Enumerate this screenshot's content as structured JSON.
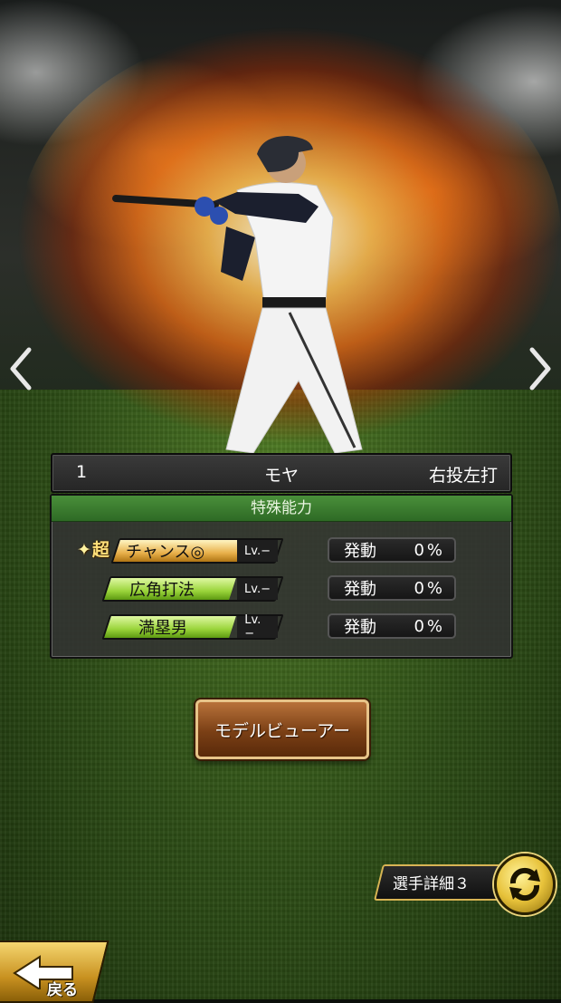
{
  "player": {
    "number": "1",
    "name": "モヤ",
    "handedness": "右投左打"
  },
  "abilities": {
    "header": "特殊能力",
    "items": [
      {
        "prefix": "超",
        "name": "チャンス◎",
        "level": "Lv.−",
        "effect_label": "発動",
        "effect_value": "0%",
        "color": "#e8b04a"
      },
      {
        "prefix": "",
        "name": "広角打法",
        "level": "Lv.−",
        "effect_label": "発動",
        "effect_value": "0%",
        "color": "#9ad43a"
      },
      {
        "prefix": "",
        "name": "満塁男",
        "level": "Lv.−",
        "effect_label": "発動",
        "effect_value": "0%",
        "color": "#9ad43a"
      }
    ]
  },
  "buttons": {
    "model_viewer": "モデルビューアー",
    "player_detail": "選手詳細３",
    "back": "戻る"
  },
  "icons": {
    "prev": "chevron-left-icon",
    "next": "chevron-right-icon",
    "swap": "swap-arrows-icon",
    "back": "back-arrow-icon"
  }
}
